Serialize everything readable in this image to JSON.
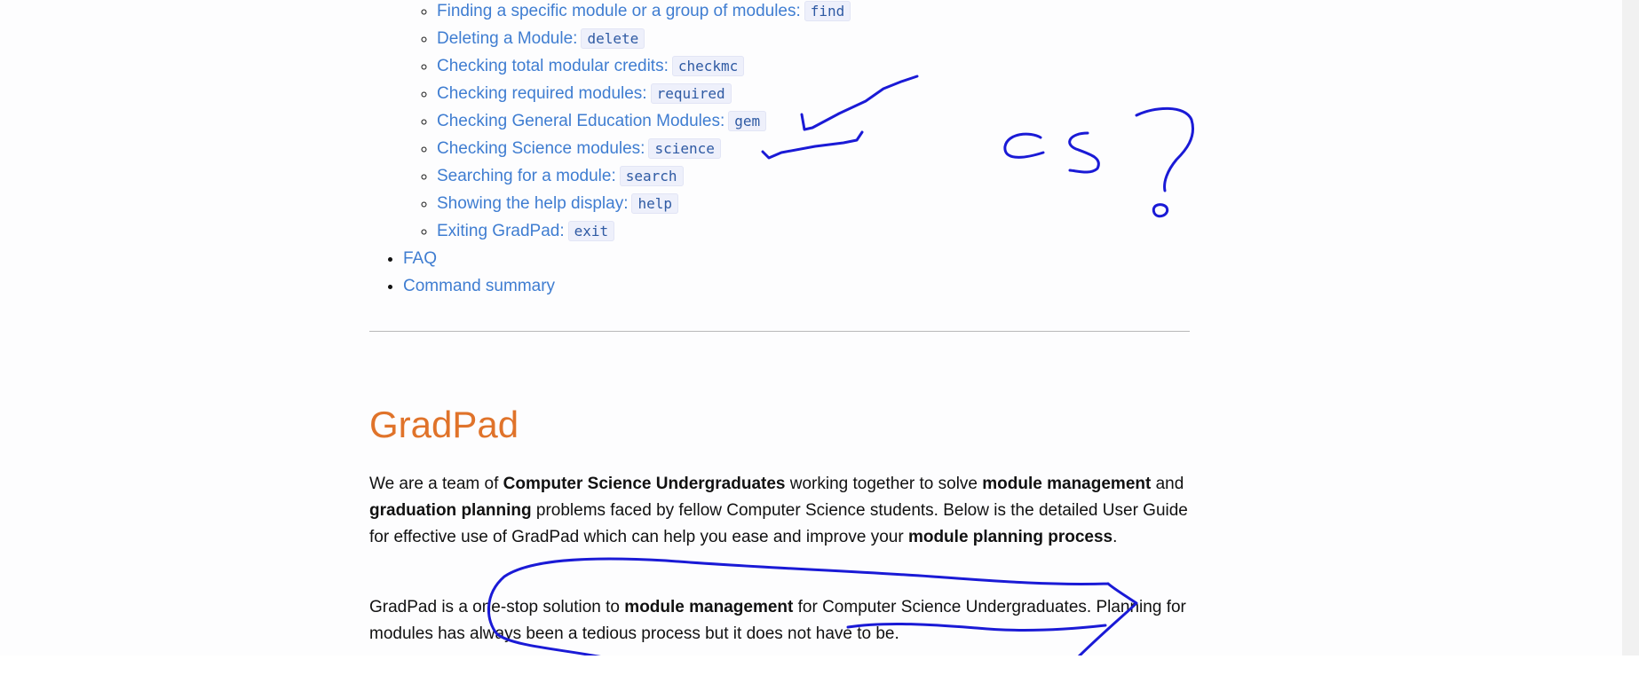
{
  "toc": {
    "sub_items": [
      {
        "label": "Finding a specific module or a group of modules:",
        "code": "find"
      },
      {
        "label": "Deleting a Module:",
        "code": "delete"
      },
      {
        "label": "Checking total modular credits:",
        "code": "checkmc"
      },
      {
        "label": "Checking required modules:",
        "code": "required"
      },
      {
        "label": "Checking General Education Modules:",
        "code": "gem"
      },
      {
        "label": "Checking Science modules:",
        "code": "science"
      },
      {
        "label": "Searching for a module:",
        "code": "search"
      },
      {
        "label": "Showing the help display:",
        "code": "help"
      },
      {
        "label": "Exiting GradPad:",
        "code": "exit"
      }
    ],
    "items": [
      "FAQ",
      "Command summary"
    ]
  },
  "section": {
    "title": "GradPad",
    "p1": [
      "We are a team of ",
      "Computer Science Undergraduates",
      " working together to solve ",
      "module management",
      " and ",
      "graduation planning",
      " problems faced by fellow Computer Science students. Below is the detailed User Guide for effective use of GradPad which can help you ease and improve your ",
      "module planning process",
      "."
    ],
    "p2": [
      "GradPad is a one-stop solution to ",
      "module management",
      " for Computer Science Undergraduates. Planning for modules has always been a tedious process but it does not have to be."
    ]
  },
  "annotation": {
    "handwritten_text": "CS?",
    "ink_color": "#1a1ad6"
  }
}
